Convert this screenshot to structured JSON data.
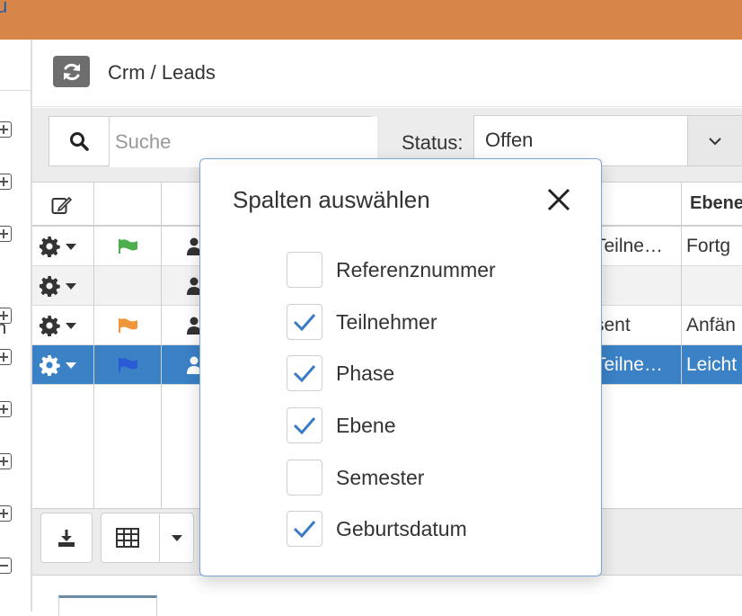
{
  "topbar": {
    "logo_fragment": "u",
    "color": "#d8854a"
  },
  "breadcrumb": {
    "title": "Crm / Leads",
    "refresh_icon": "refresh-icon"
  },
  "filter": {
    "search_placeholder": "Suche",
    "status_label": "Status:",
    "status_value": "Offen"
  },
  "grid": {
    "header": {
      "edit_icon": "edit-icon",
      "ebene_label": "Ebene"
    },
    "rows": [
      {
        "flag_color": "#4cae4c",
        "phase": "Teilne…",
        "ebene": "Fortg",
        "style": "normal"
      },
      {
        "flag_color": "",
        "phase": "",
        "ebene": "",
        "style": "alt"
      },
      {
        "flag_color": "#f0963a",
        "phase": "sent",
        "ebene": "Anfän",
        "style": "normal"
      },
      {
        "flag_color": "#2a5bd7",
        "phase": "Teilne…",
        "ebene": "Leicht",
        "style": "selected"
      }
    ],
    "selected_row_color": "#3a81c6"
  },
  "toolbar": {
    "download_icon": "download-icon",
    "table_icon": "table-icon",
    "dropdown_icon": "caret-down-icon"
  },
  "sidebar": {
    "letter": "n"
  },
  "modal": {
    "title": "Spalten auswählen",
    "close_icon": "close-icon",
    "options": [
      {
        "label": "Referenznummer",
        "checked": false
      },
      {
        "label": "Teilnehmer",
        "checked": true
      },
      {
        "label": "Phase",
        "checked": true
      },
      {
        "label": "Ebene",
        "checked": true
      },
      {
        "label": "Semester",
        "checked": false
      },
      {
        "label": "Geburtsdatum",
        "checked": true
      }
    ],
    "check_color": "#3a7bc8"
  }
}
